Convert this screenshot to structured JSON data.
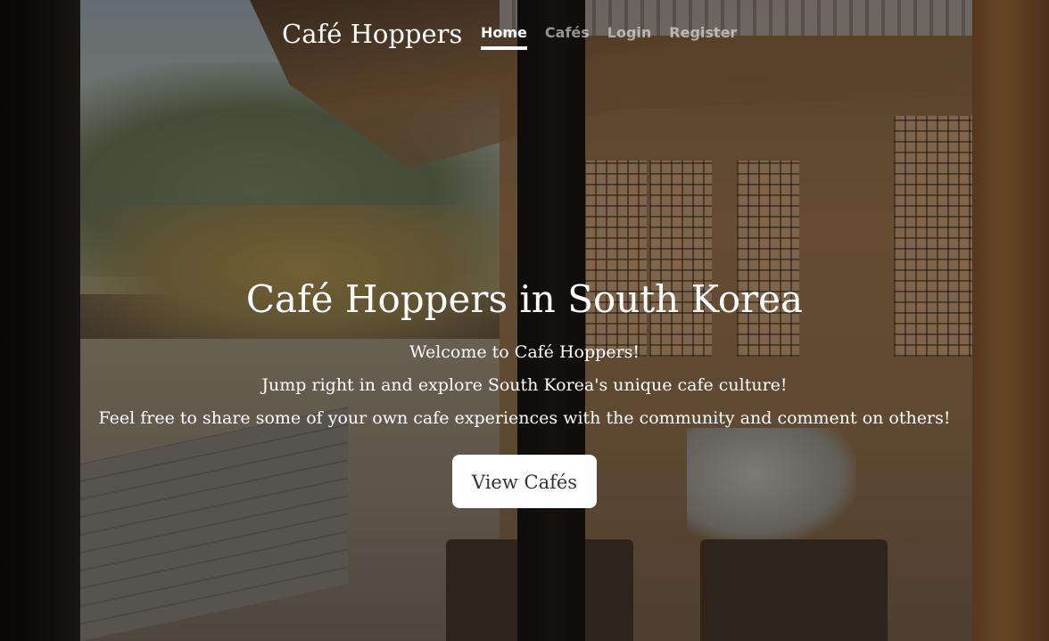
{
  "nav": {
    "brand": "Café Hoppers",
    "links": [
      {
        "label": "Home",
        "active": true
      },
      {
        "label": "Cafés",
        "active": false
      },
      {
        "label": "Login",
        "active": false
      },
      {
        "label": "Register",
        "active": false
      }
    ]
  },
  "hero": {
    "title": "Café Hoppers in South Korea",
    "lines": [
      "Welcome to Café Hoppers!",
      "Jump right in and explore South Korea's unique cafe culture!",
      "Feel free to share some of your own cafe experiences with the community and comment on others!"
    ],
    "cta_label": "View Cafés"
  }
}
